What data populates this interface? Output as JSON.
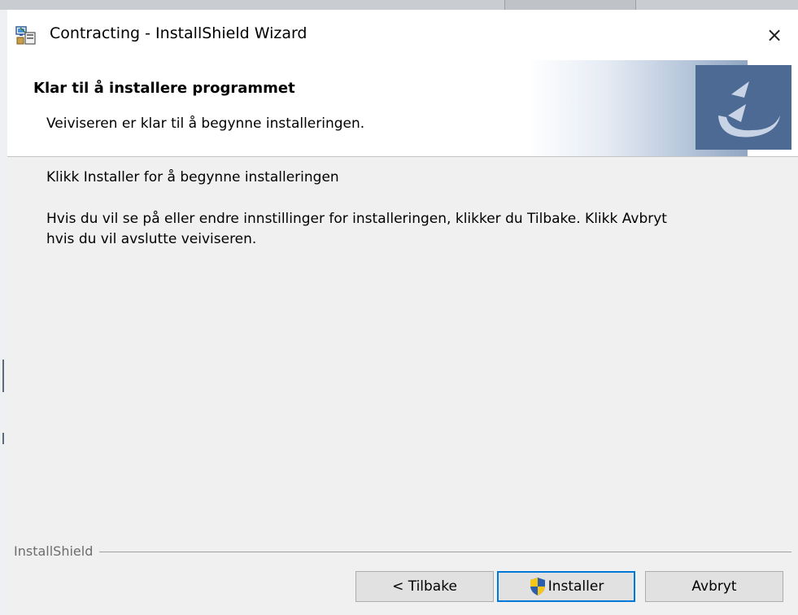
{
  "window": {
    "title": "Contracting - InstallShield Wizard",
    "close_symbol": "×"
  },
  "banner": {
    "title": "Klar til å installere programmet",
    "subtitle": "Veiviseren er klar til å begynne installeringen."
  },
  "main": {
    "line1": "Klikk Installer for å begynne installeringen",
    "line2a": "Hvis du vil se på eller endre innstillinger for installeringen, klikker du Tilbake. Klikk Avbryt",
    "line2b": "hvis du vil avslutte veiviseren."
  },
  "footer": {
    "brand": "InstallShield"
  },
  "buttons": {
    "back": "< Tilbake",
    "install": "Installer",
    "cancel": "Avbryt"
  },
  "colors": {
    "banner_logo": "#4d6a95",
    "default_button_border": "#0078d7",
    "window_bg": "#f0f0f0"
  },
  "icons": {
    "app": "installer-computer-icon",
    "close": "close-icon",
    "logo": "installshield-swirl-icon",
    "uac": "uac-shield-icon"
  }
}
